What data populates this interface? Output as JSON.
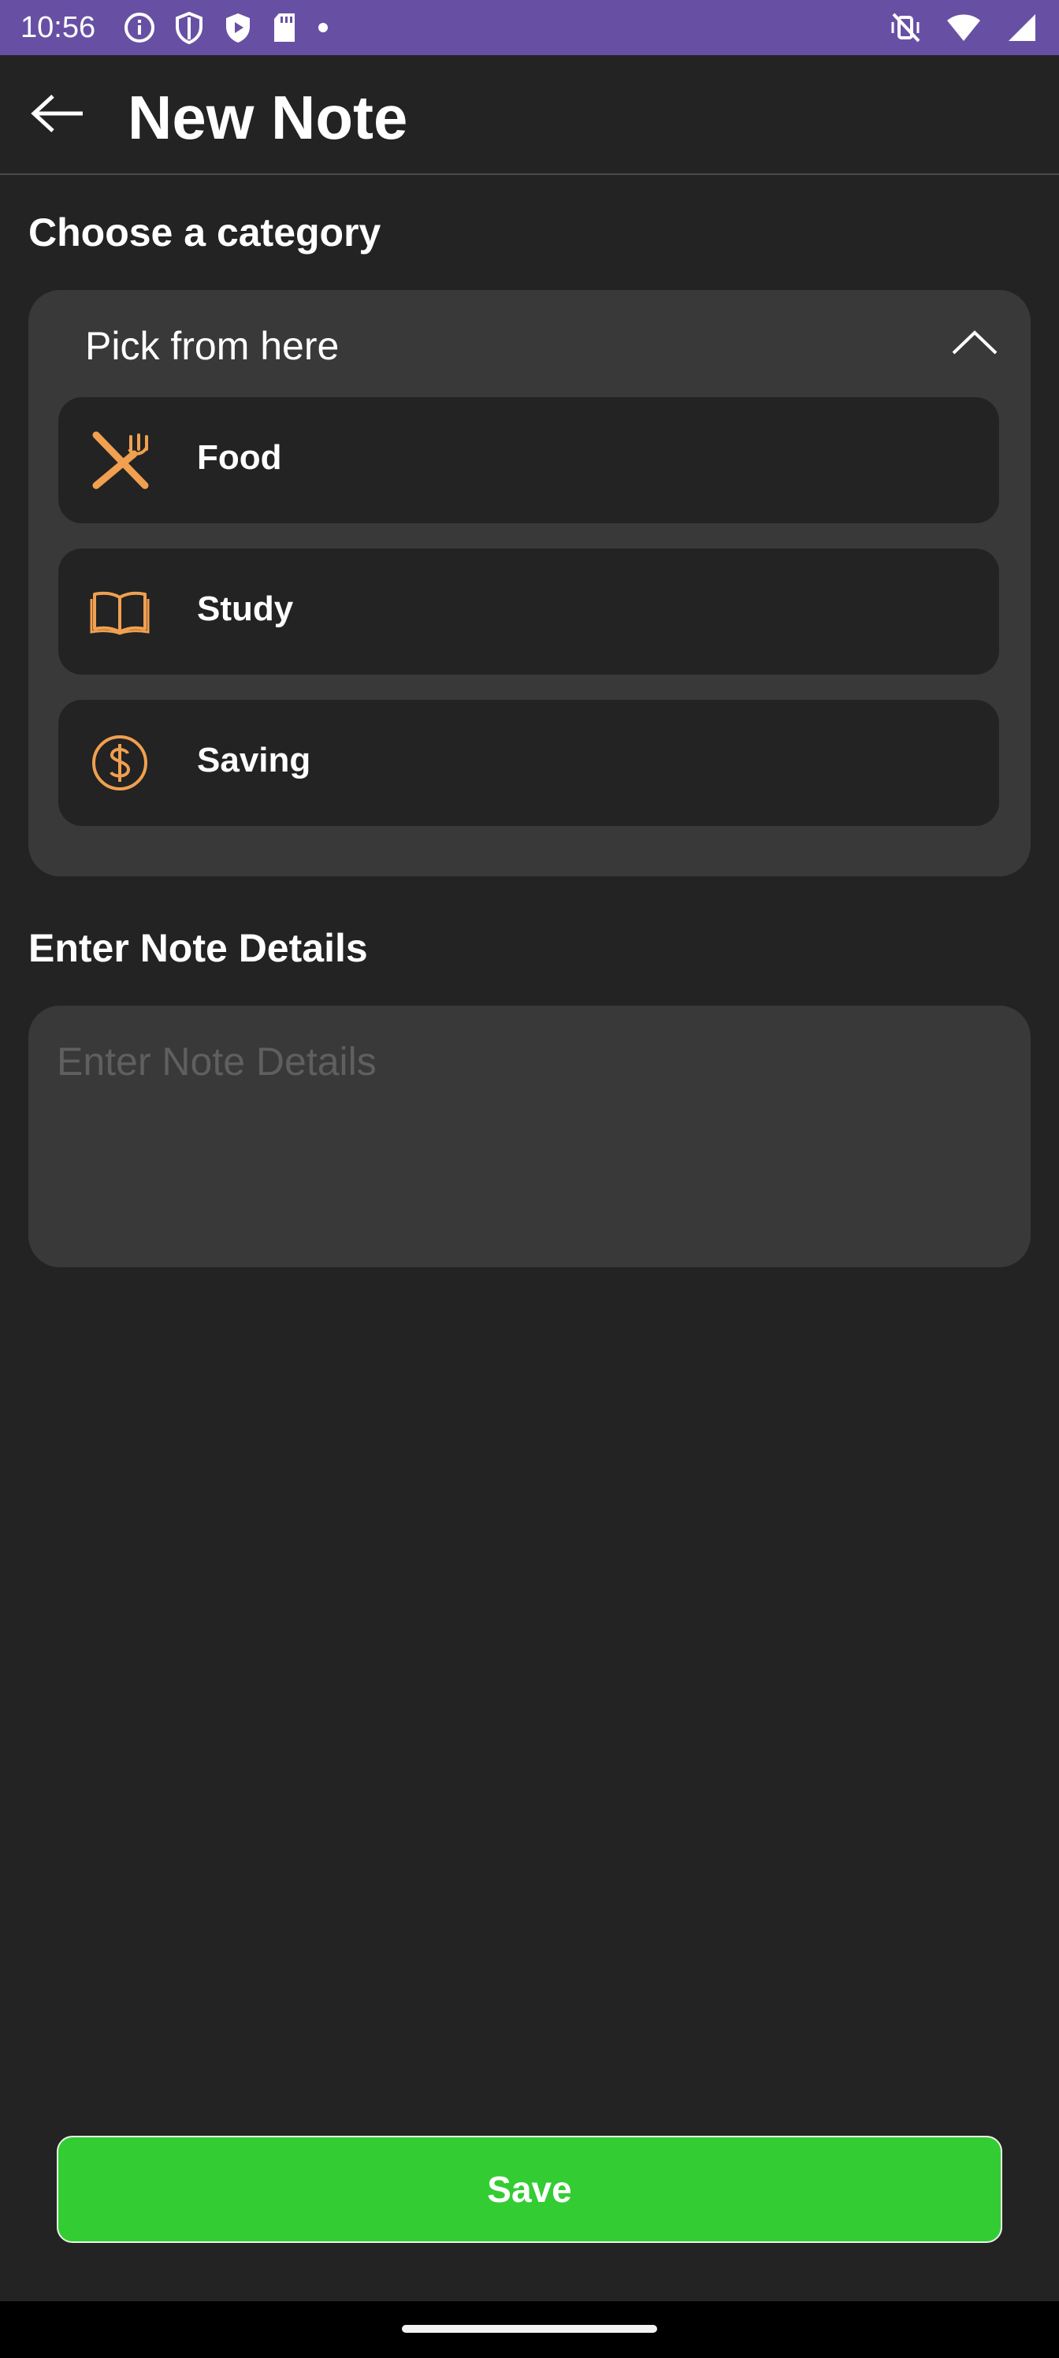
{
  "status_bar": {
    "time": "10:56",
    "left_icons": [
      "info-icon",
      "shield-icon",
      "play-shield-icon",
      "sd-card-icon",
      "dot-icon"
    ],
    "right_icons": [
      "vibrate-off-icon",
      "wifi-icon",
      "signal-icon"
    ],
    "background_color": "#6750a4"
  },
  "app_bar": {
    "back_icon": "arrow-left-icon",
    "title": "New Note"
  },
  "category_section": {
    "title": "Choose a category",
    "dropdown": {
      "label": "Pick from here",
      "chevron_icon": "chevron-up-icon",
      "options": [
        {
          "label": "Food",
          "icon": "fork-knife-icon"
        },
        {
          "label": "Study",
          "icon": "book-icon"
        },
        {
          "label": "Saving",
          "icon": "dollar-circle-icon"
        }
      ]
    }
  },
  "notes_section": {
    "title": "Enter Note Details",
    "input": {
      "placeholder": "Enter Note Details",
      "value": ""
    }
  },
  "save_button": {
    "label": "Save",
    "color": "#33cc33"
  },
  "theme": {
    "background": "#232323",
    "surface": "#393939",
    "accent_icon": "#f0a050"
  }
}
